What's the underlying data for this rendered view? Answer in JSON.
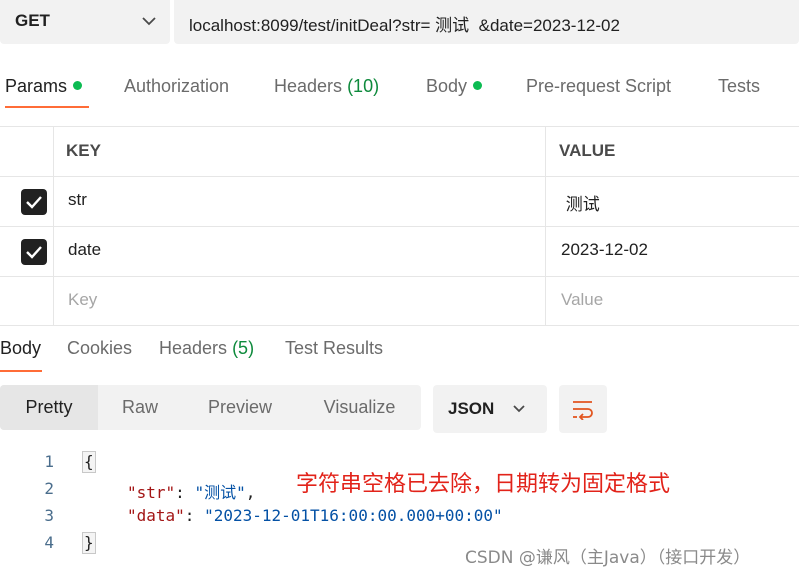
{
  "request": {
    "method": "GET",
    "url": "localhost:8099/test/initDeal?str= 测试  &date=2023-12-02"
  },
  "request_tabs": [
    {
      "label": "Params",
      "dot": true
    },
    {
      "label": "Authorization"
    },
    {
      "label": "Headers",
      "count": "(10)"
    },
    {
      "label": "Body",
      "dot": true
    },
    {
      "label": "Pre-request Script"
    },
    {
      "label": "Tests"
    }
  ],
  "params": {
    "columns": {
      "key": "KEY",
      "value": "VALUE"
    },
    "rows": [
      {
        "key": "str",
        "value": " 测试  ",
        "checked": true
      },
      {
        "key": "date",
        "value": "2023-12-02",
        "checked": true
      }
    ],
    "placeholder": {
      "key": "Key",
      "value": "Value"
    }
  },
  "response_tabs": [
    {
      "label": "Body"
    },
    {
      "label": "Cookies"
    },
    {
      "label": "Headers",
      "count": "(5)"
    },
    {
      "label": "Test Results"
    }
  ],
  "view_modes": [
    "Pretty",
    "Raw",
    "Preview",
    "Visualize"
  ],
  "format": "JSON",
  "code": {
    "line_numbers": [
      "1",
      "2",
      "3",
      "4"
    ],
    "open_brace": "{",
    "close_brace": "}",
    "lines": [
      {
        "key": "\"str\"",
        "sep": ": ",
        "value": "\"测试\"",
        "trail": ","
      },
      {
        "key": "\"data\"",
        "sep": ": ",
        "value": "\"2023-12-01T16:00:00.000+00:00\"",
        "trail": ""
      }
    ]
  },
  "annotation": "字符串空格已去除，日期转为固定格式",
  "watermark": "CSDN @谦风（主Java）（接口开发）",
  "colors": {
    "accent": "#ff6c37",
    "status_dot": "#0cbb52",
    "annotation": "#e2231a"
  }
}
